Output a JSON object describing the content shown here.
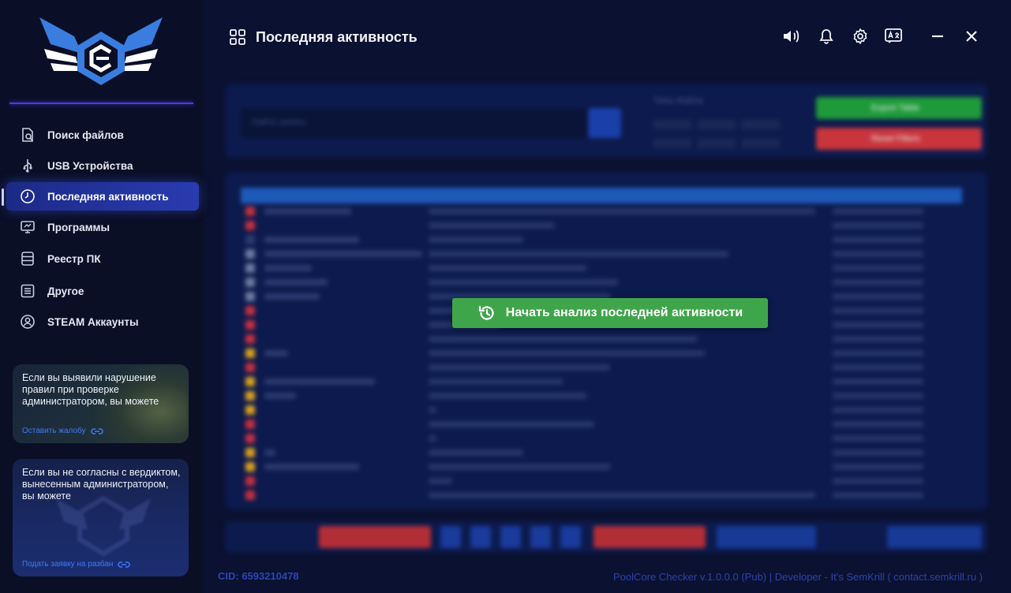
{
  "header": {
    "title": "Последняя активность"
  },
  "sidebar": {
    "items": [
      {
        "label": "Поиск файлов",
        "icon": "file-search-icon"
      },
      {
        "label": "USB Устройства",
        "icon": "usb-icon"
      },
      {
        "label": "Последняя активность",
        "icon": "clock-icon",
        "active": true
      },
      {
        "label": "Программы",
        "icon": "monitor-icon"
      },
      {
        "label": "Реестр ПК",
        "icon": "registry-icon"
      },
      {
        "label": "Другое",
        "icon": "list-icon"
      },
      {
        "label": "STEAM Аккаунты",
        "icon": "user-circle-icon"
      }
    ],
    "promo1": {
      "text": "Если вы выявили нарушение правил при проверке администратором, вы можете",
      "link": "Оставить жалобу"
    },
    "promo2": {
      "text": "Если вы не согласны с вердиктом, вынесенным администратором, вы можете",
      "link": "Подать заявку на разбан"
    }
  },
  "main": {
    "analyze_button": "Начать анализ последней активности"
  },
  "footer": {
    "cid": "CID: 6593210478",
    "credits": "PoolCore Checker v.1.0.0.0 (Pub) | Developer - It's SemKrill ( contact.semkrill.ru )"
  },
  "colors": {
    "accent": "#2a3bb0",
    "analyze": "#3fa54a",
    "background": "#0b1130"
  }
}
